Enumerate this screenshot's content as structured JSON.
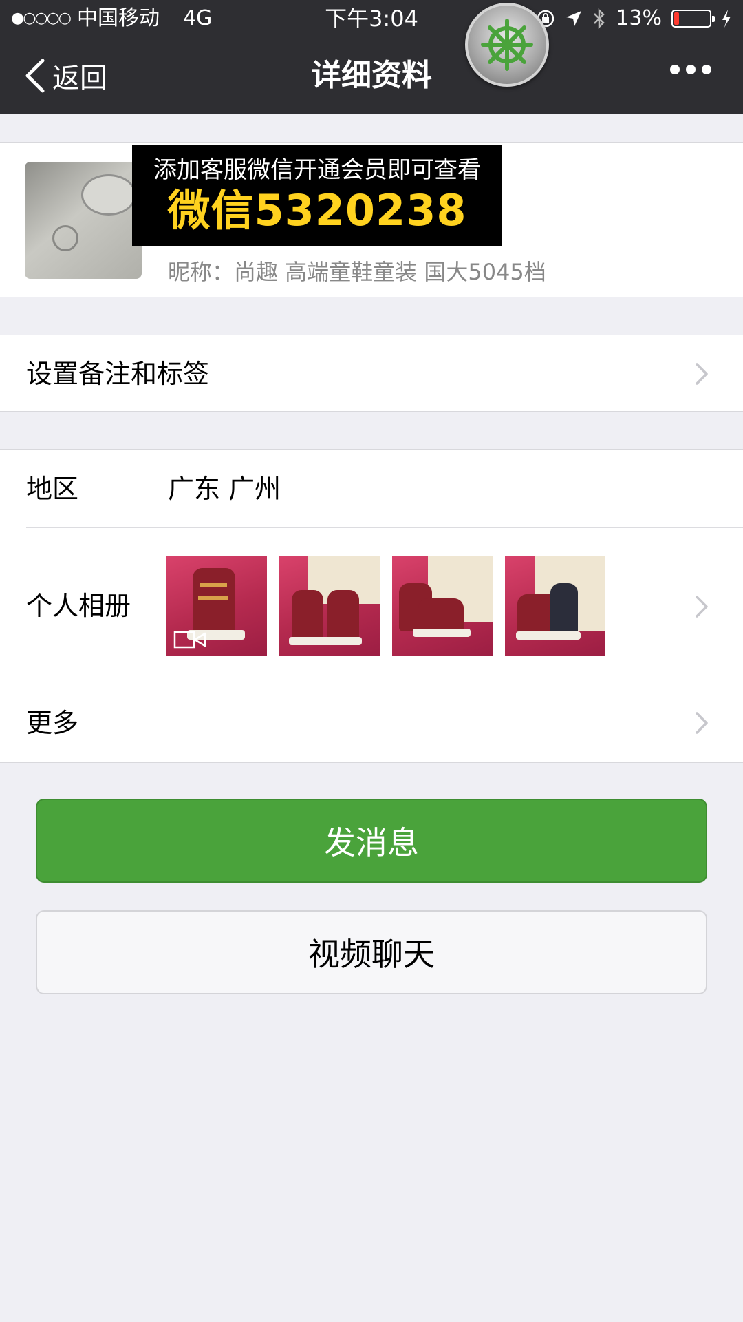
{
  "status_bar": {
    "signal": "●○○○○",
    "carrier": "中国移动",
    "network": "4G",
    "time": "下午3:04",
    "battery_percent": "13%",
    "battery_level": 0.13
  },
  "nav": {
    "back_label": "返回",
    "title": "详细资料"
  },
  "profile": {
    "promo_line1": "添加客服微信开通会员即可查看",
    "promo_line2": "微信5320238",
    "nickname": "昵称：尚趣 高端童鞋童装 国大5045档"
  },
  "remark": {
    "label": "设置备注和标签"
  },
  "info": {
    "region_label": "地区",
    "region_value": "广东 广州",
    "album_label": "个人相册",
    "more_label": "更多"
  },
  "actions": {
    "send_message": "发消息",
    "video_chat": "视频聊天"
  },
  "colors": {
    "header_bg": "#2e2e32",
    "primary_green": "#4aa33b",
    "promo_yellow": "#ffd21f",
    "page_bg": "#efeff4"
  }
}
